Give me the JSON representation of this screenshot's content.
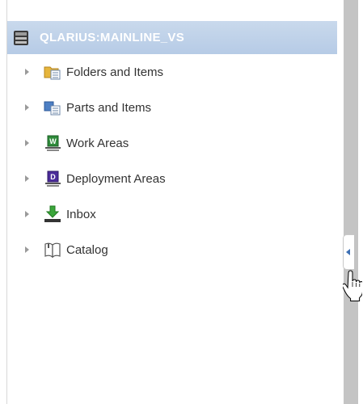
{
  "tree": {
    "root": {
      "label": "QLARIUS:MAINLINE_VS",
      "icon": "server-icon"
    },
    "items": [
      {
        "label": "Folders and Items",
        "icon": "folder-items-icon"
      },
      {
        "label": "Parts and Items",
        "icon": "parts-items-icon"
      },
      {
        "label": "Work Areas",
        "icon": "work-area-icon"
      },
      {
        "label": "Deployment Areas",
        "icon": "deployment-area-icon"
      },
      {
        "label": "Inbox",
        "icon": "inbox-icon"
      },
      {
        "label": "Catalog",
        "icon": "catalog-icon"
      }
    ]
  },
  "icons": {
    "work_area_letter": "W",
    "deployment_area_letter": "D"
  },
  "colors": {
    "root_bg": "#c0d3ea",
    "root_text": "#ffffff",
    "splitter": "#c4c4c4",
    "splitter_arrow": "#3c6fb4"
  }
}
